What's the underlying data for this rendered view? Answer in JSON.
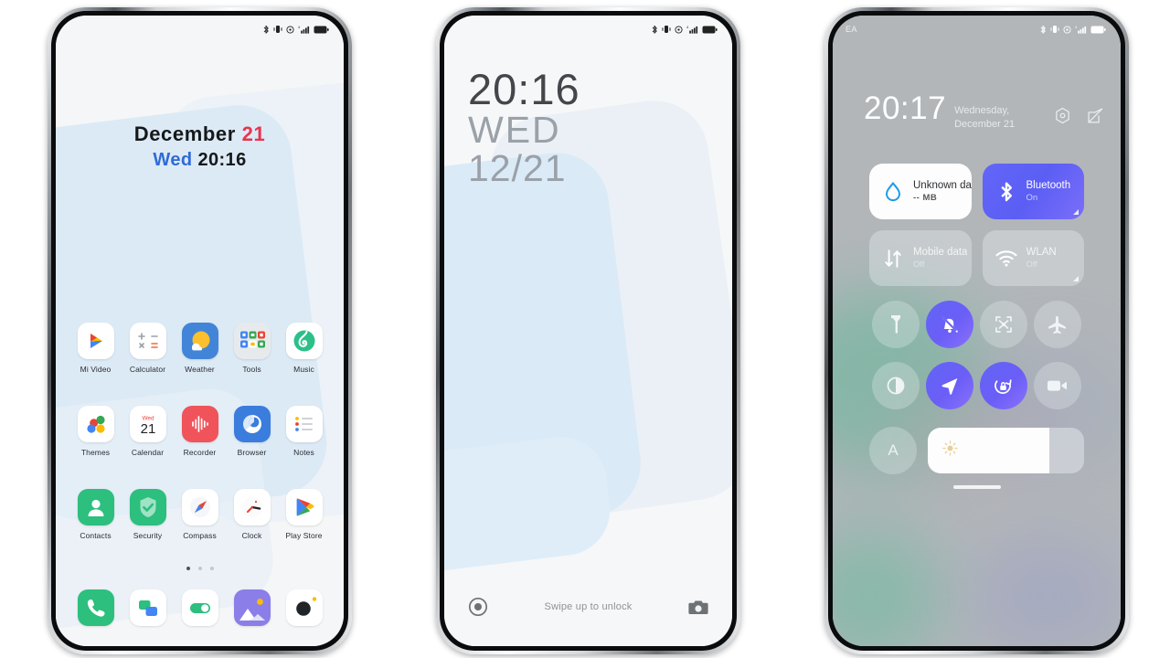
{
  "meta": {
    "accent_red": "#e8354e",
    "accent_blue": "#2f6bd8",
    "accent_purple": "#6366f7",
    "wallpaper_blue": "#daeaf7"
  },
  "phone1": {
    "name": "home-screen",
    "statusbar": {
      "icons": [
        "bluetooth-icon",
        "vibrate-icon",
        "alarm-icon",
        "signal-icon",
        "battery-icon"
      ]
    },
    "widget": {
      "month": "December",
      "day": "21",
      "weekday": "Wed",
      "time": "20:16"
    },
    "apps": [
      [
        {
          "label": "Mi Video",
          "icon": "mi-video-icon"
        },
        {
          "label": "Calculator",
          "icon": "calculator-icon"
        },
        {
          "label": "Weather",
          "icon": "weather-icon"
        },
        {
          "label": "Tools",
          "icon": "tools-folder-icon"
        },
        {
          "label": "Music",
          "icon": "music-icon"
        }
      ],
      [
        {
          "label": "Themes",
          "icon": "themes-icon"
        },
        {
          "label": "Calendar",
          "icon": "calendar-icon",
          "badge_weekday": "Wed",
          "badge_day": "21"
        },
        {
          "label": "Recorder",
          "icon": "recorder-icon"
        },
        {
          "label": "Browser",
          "icon": "browser-icon"
        },
        {
          "label": "Notes",
          "icon": "notes-icon"
        }
      ],
      [
        {
          "label": "Contacts",
          "icon": "contacts-icon"
        },
        {
          "label": "Security",
          "icon": "security-icon"
        },
        {
          "label": "Compass",
          "icon": "compass-icon"
        },
        {
          "label": "Clock",
          "icon": "clock-icon"
        },
        {
          "label": "Play Store",
          "icon": "play-store-icon"
        }
      ]
    ],
    "page_dots": {
      "count": 3,
      "active": 0
    },
    "dock": [
      {
        "label": "Phone",
        "icon": "phone-icon"
      },
      {
        "label": "Messages",
        "icon": "messages-icon"
      },
      {
        "label": "Settings",
        "icon": "settings-toggle-icon"
      },
      {
        "label": "Gallery",
        "icon": "gallery-icon"
      },
      {
        "label": "Camera",
        "icon": "camera-icon"
      }
    ]
  },
  "phone2": {
    "name": "lock-screen",
    "statusbar": {
      "icons": [
        "bluetooth-icon",
        "vibrate-icon",
        "alarm-icon",
        "signal-icon",
        "battery-icon"
      ]
    },
    "clock": {
      "time": "20:16",
      "weekday": "WED",
      "date": "12/21"
    },
    "bottom": {
      "left_icon": "record-circle-icon",
      "hint": "Swipe up to unlock",
      "right_icon": "camera-icon"
    }
  },
  "phone3": {
    "name": "control-center",
    "statusbar": {
      "carrier": "EA",
      "icons": [
        "bluetooth-icon",
        "vibrate-icon",
        "alarm-icon",
        "signal-icon",
        "battery-icon"
      ]
    },
    "header": {
      "time": "20:17",
      "date": "Wednesday, December 21",
      "actions": [
        {
          "icon": "settings-hex-icon"
        },
        {
          "icon": "edit-icon"
        }
      ]
    },
    "cards": [
      {
        "title": "Unknown data plan",
        "sub": "-- MB",
        "icon": "data-drop-icon",
        "state": "white",
        "expand": false
      },
      {
        "title": "Bluetooth",
        "sub": "On",
        "icon": "bluetooth-icon",
        "state": "on",
        "expand": true
      },
      {
        "title": "Mobile data",
        "sub": "Off",
        "icon": "mobile-data-icon",
        "state": "off",
        "expand": false
      },
      {
        "title": "WLAN",
        "sub": "Off",
        "icon": "wlan-icon",
        "state": "off",
        "expand": true
      }
    ],
    "toggles": [
      {
        "name": "flashlight",
        "icon": "flashlight-icon",
        "state": "off"
      },
      {
        "name": "silent",
        "icon": "bell-slash-icon",
        "state": "on"
      },
      {
        "name": "screenshot",
        "icon": "screenshot-icon",
        "state": "off"
      },
      {
        "name": "airplane-mode",
        "icon": "airplane-icon",
        "state": "off"
      },
      {
        "name": "dark-mode",
        "icon": "contrast-icon",
        "state": "off"
      },
      {
        "name": "location",
        "icon": "location-arrow-icon",
        "state": "on"
      },
      {
        "name": "rotation-lock",
        "icon": "rotation-lock-icon",
        "state": "on"
      },
      {
        "name": "screen-recorder",
        "icon": "video-camera-icon",
        "state": "off"
      }
    ],
    "brightness": {
      "auto_label": "A",
      "icon": "sun-icon",
      "percent": 78
    }
  }
}
